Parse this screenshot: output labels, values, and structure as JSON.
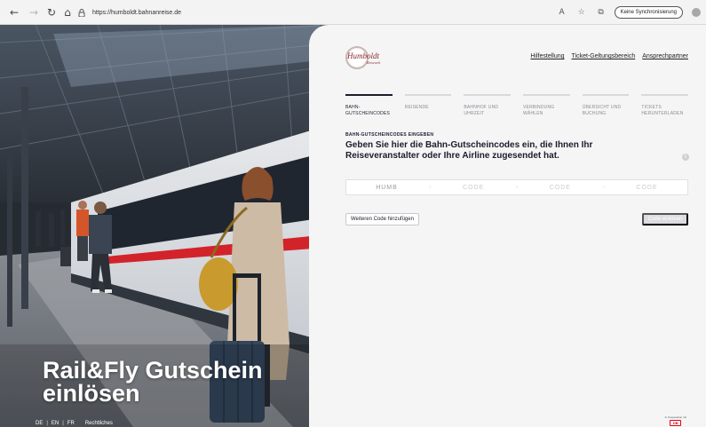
{
  "browser": {
    "url": "https://humboldt.bahnanreise.de",
    "sync_label": "Keine Synchronisierung"
  },
  "hero": {
    "title_line1": "Rail&Fly Gutschein",
    "title_line2": "einlösen"
  },
  "footer": {
    "languages": [
      "DE",
      "EN",
      "FR"
    ],
    "legal": "Rechtliches",
    "partner_label": "In Kooperation mit",
    "partner_logo_text": "DB"
  },
  "panel": {
    "logo_text": "Humboldt",
    "logo_sub": "Reisewelt",
    "top_links": [
      "Hilfestellung",
      "Ticket-Geltungsbereich",
      "Ansprechpartner"
    ],
    "steps": [
      {
        "label": "Bahn-Gutscheincodes",
        "active": true
      },
      {
        "label": "Reisende",
        "active": false
      },
      {
        "label": "Bahnhof und Uhrzeit",
        "active": false
      },
      {
        "label": "Verbindung wählen",
        "active": false
      },
      {
        "label": "Übersicht und Buchung",
        "active": false
      },
      {
        "label": "Tickets herunterladen",
        "active": false
      }
    ],
    "section_label": "BAHN-GUTSCHEINCODES EINGEBEN",
    "heading": "Geben Sie hier die Bahn-Gutscheincodes ein, die Ihnen Ihr Reiseveranstalter oder Ihre Airline zugesendet hat.",
    "code_fields": [
      {
        "value": "HUMB",
        "placeholder": ""
      },
      {
        "value": "",
        "placeholder": "CODE"
      },
      {
        "value": "",
        "placeholder": "CODE"
      },
      {
        "value": "",
        "placeholder": "CODE"
      }
    ],
    "separator": "-",
    "add_code_label": "Weiteren Code hinzufügen",
    "verify_label": "Code einlösen"
  },
  "colors": {
    "accent": "#1c1c2b",
    "brand": "#8a2b2b",
    "db_red": "#e3000f"
  }
}
